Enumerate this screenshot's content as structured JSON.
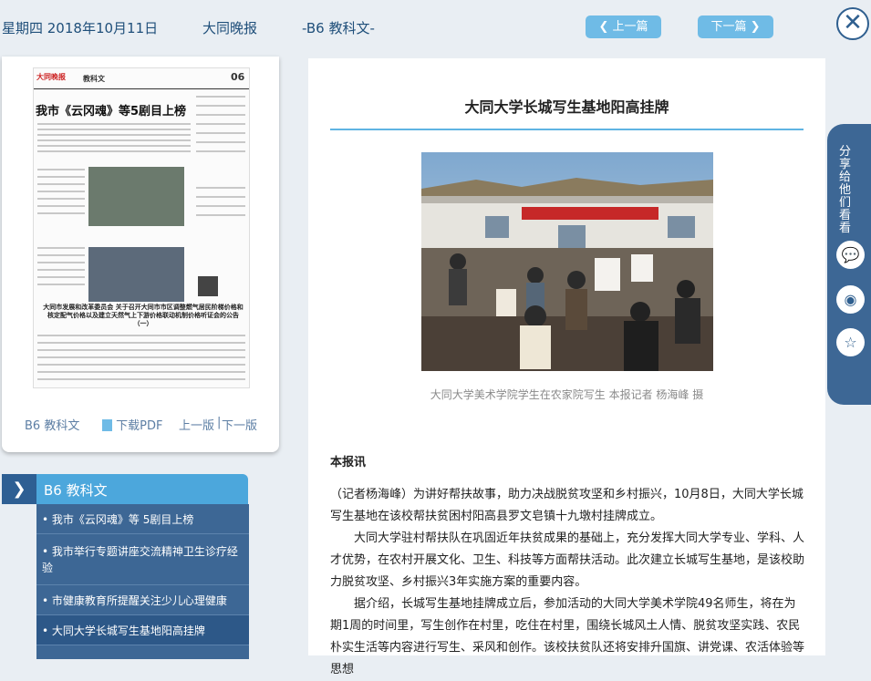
{
  "topbar": {
    "date": "星期四 2018年10月11日",
    "paper": "大同晚报",
    "section": "-B6 教科文-",
    "prev_label": "上一篇",
    "next_label": "下一篇"
  },
  "thumbnail": {
    "masthead": "大同晚报",
    "section": "教科文",
    "page_no": "06",
    "headline": "我市《云冈魂》等5剧目上榜",
    "bottom_heading": "大同市发展和改革委员会 关于召开大同市市区调整燃气居民阶梯价格和核定配气价格以及建立天然气上下游价格联动机制价格听证会的公告（一）",
    "footer_section": "B6 教科文",
    "download_pdf": "下载PDF",
    "prev_page": "上一版",
    "separator": "|",
    "next_page": "下一版"
  },
  "section_nav": {
    "title": "B6  教科文",
    "items": [
      "• 我市《云冈魂》等 5剧目上榜",
      "• 我市举行专题讲座交流精神卫生诊疗经验",
      "• 市健康教育所提醒关注少儿心理健康",
      "• 大同大学长城写生基地阳高挂牌"
    ]
  },
  "article": {
    "title": "大同大学长城写生基地阳高挂牌",
    "caption": "大同大学美术学院学生在农家院写生 本报记者 杨海峰 摄",
    "lead": "本报讯",
    "paragraphs": [
      "（记者杨海峰）为讲好帮扶故事，助力决战脱贫攻坚和乡村振兴，10月8日，大同大学长城写生基地在该校帮扶贫困村阳高县罗文皂镇十九墩村挂牌成立。",
      "　　大同大学驻村帮扶队在巩固近年扶贫成果的基础上，充分发挥大同大学专业、学科、人才优势，在农村开展文化、卫生、科技等方面帮扶活动。此次建立长城写生基地，是该校助力脱贫攻坚、乡村振兴3年实施方案的重要内容。",
      "　　据介绍，长城写生基地挂牌成立后，参加活动的大同大学美术学院49名师生，将在为期1周的时间里，写生创作在村里，吃住在村里，围绕长城风土人情、脱贫攻坚实践、农民朴实生活等内容进行写生、采风和创作。该校扶贫队还将安排升国旗、讲党课、农活体验等思想"
    ]
  },
  "share": {
    "label": "分享给他们看看",
    "icons": [
      "wechat-icon",
      "weibo-icon",
      "favorite-icon"
    ]
  },
  "colors": {
    "accent": "#4ca7dc",
    "nav_dark": "#3d6795",
    "nav_button": "#6fbbe6"
  }
}
